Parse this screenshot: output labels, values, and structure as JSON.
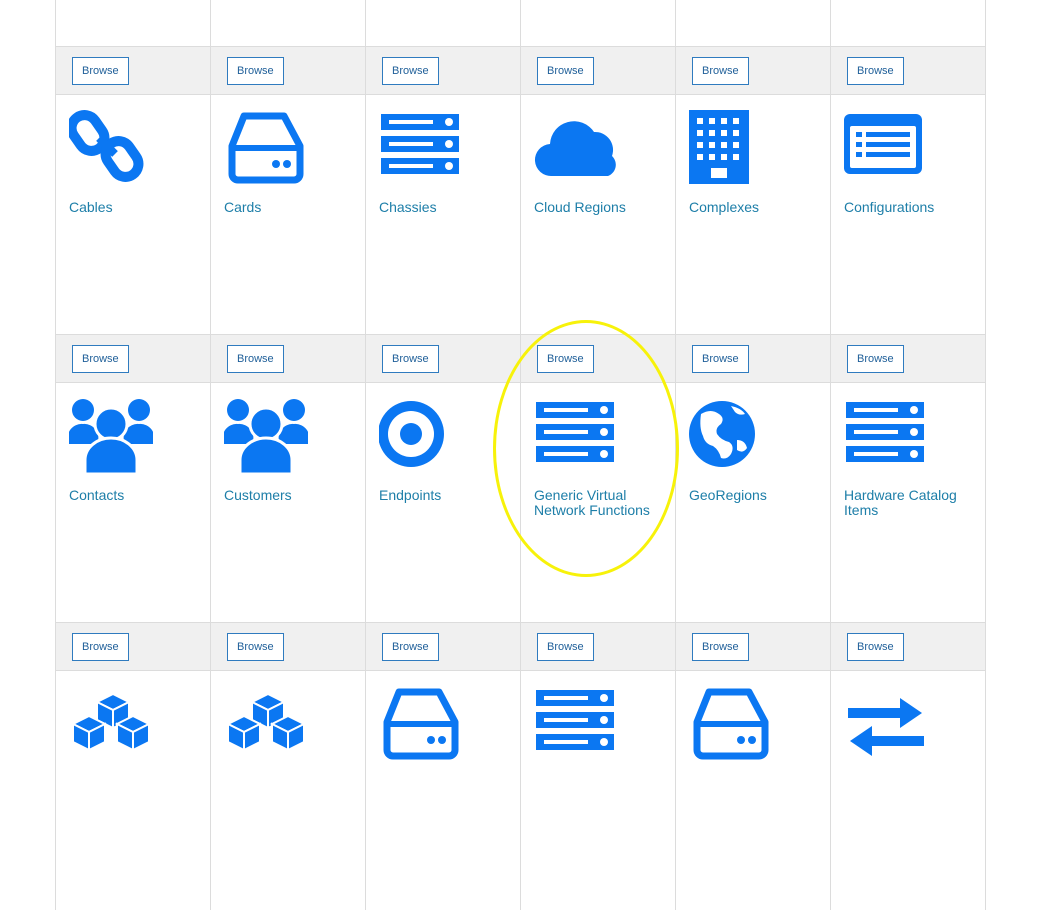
{
  "browse_label": "Browse",
  "accent_color": "#0b77f2",
  "rows": [
    [
      {
        "label": "",
        "icon": "blank"
      },
      {
        "label": "",
        "icon": "blank"
      },
      {
        "label": "",
        "icon": "blank"
      },
      {
        "label": "",
        "icon": "blank"
      },
      {
        "label": "",
        "icon": "blank"
      },
      {
        "label": "",
        "icon": "blank"
      }
    ],
    [
      {
        "label": "Cables",
        "icon": "chain-link-icon"
      },
      {
        "label": "Cards",
        "icon": "hard-drive-icon"
      },
      {
        "label": "Chassies",
        "icon": "server-rack-icon"
      },
      {
        "label": "Cloud Regions",
        "icon": "cloud-icon"
      },
      {
        "label": "Complexes",
        "icon": "building-icon"
      },
      {
        "label": "Configurations",
        "icon": "list-window-icon"
      }
    ],
    [
      {
        "label": "Contacts",
        "icon": "users-group-icon"
      },
      {
        "label": "Customers",
        "icon": "users-group-icon"
      },
      {
        "label": "Endpoints",
        "icon": "target-icon"
      },
      {
        "label": "Generic Virtual Network Functions",
        "icon": "server-rack-icon"
      },
      {
        "label": "GeoRegions",
        "icon": "globe-icon"
      },
      {
        "label": "Hardware Catalog Items",
        "icon": "server-rack-icon"
      }
    ],
    [
      {
        "label": "",
        "icon": "cubes-icon"
      },
      {
        "label": "",
        "icon": "cubes-icon"
      },
      {
        "label": "",
        "icon": "hard-drive-icon"
      },
      {
        "label": "",
        "icon": "server-rack-icon"
      },
      {
        "label": "",
        "icon": "hard-drive-icon"
      },
      {
        "label": "",
        "icon": "exchange-arrows-icon"
      }
    ]
  ]
}
